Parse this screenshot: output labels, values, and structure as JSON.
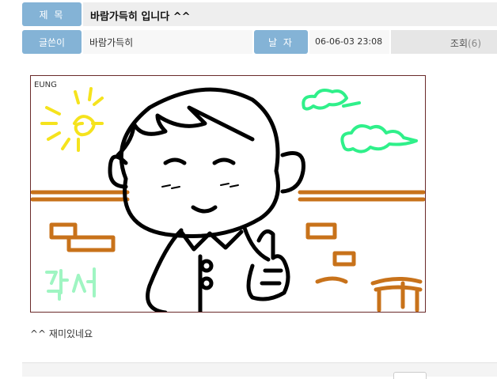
{
  "post": {
    "title_label": "제 목",
    "title": "바람가득히 입니다 ^^",
    "writer_label": "글쓴이",
    "writer": "바람가득히",
    "date_label": "날 자",
    "date": "06-06-03 23:08",
    "views_label": "조회",
    "views_count": "(6)"
  },
  "drawing": {
    "signature": "EUNG",
    "doodle_text": "낙서"
  },
  "body": {
    "comment": "^^ 재미있네요"
  },
  "colors": {
    "label_bg": "#84b3d6",
    "sun": "#f5e31d",
    "cloud": "#2ff08a",
    "brick": "#c8721a",
    "doodle_text": "#9ff5c2"
  }
}
